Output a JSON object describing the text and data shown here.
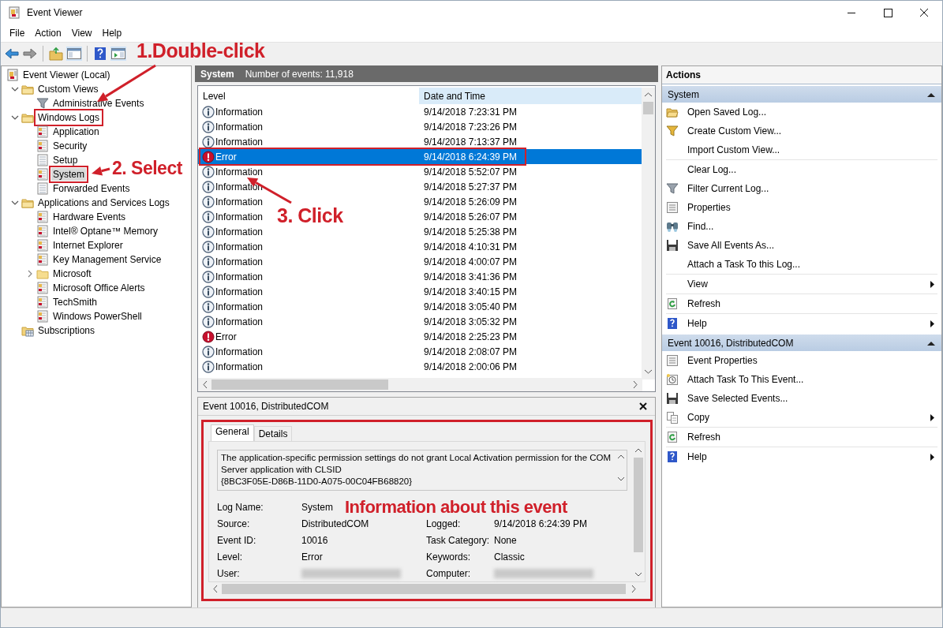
{
  "window": {
    "title": "Event Viewer"
  },
  "menu": [
    {
      "label": "File"
    },
    {
      "label": "Action"
    },
    {
      "label": "View"
    },
    {
      "label": "Help"
    }
  ],
  "tree": [
    {
      "label": "Event Viewer (Local)",
      "kind": "viewer",
      "selected": false,
      "marked": false,
      "children": [
        {
          "label": "Custom Views",
          "kind": "folder",
          "expanded": true,
          "selected": false,
          "marked": false,
          "children": [
            {
              "label": "Administrative Events",
              "kind": "filter",
              "selected": false,
              "marked": false
            }
          ]
        },
        {
          "label": "Windows Logs",
          "kind": "folder",
          "expanded": true,
          "selected": false,
          "marked": true,
          "children": [
            {
              "label": "Application",
              "kind": "log",
              "selected": false,
              "marked": false
            },
            {
              "label": "Security",
              "kind": "log",
              "selected": false,
              "marked": false
            },
            {
              "label": "Setup",
              "kind": "log-plain",
              "selected": false,
              "marked": false
            },
            {
              "label": "System",
              "kind": "log",
              "selected": true,
              "marked": true
            },
            {
              "label": "Forwarded Events",
              "kind": "log-plain",
              "selected": false,
              "marked": false
            }
          ]
        },
        {
          "label": "Applications and Services Logs",
          "kind": "folder",
          "expanded": true,
          "selected": false,
          "marked": false,
          "children": [
            {
              "label": "Hardware Events",
              "kind": "log",
              "selected": false,
              "marked": false
            },
            {
              "label": "Intel® Optane™ Memory",
              "kind": "log",
              "selected": false,
              "marked": false
            },
            {
              "label": "Internet Explorer",
              "kind": "log",
              "selected": false,
              "marked": false
            },
            {
              "label": "Key Management Service",
              "kind": "log",
              "selected": false,
              "marked": false
            },
            {
              "label": "Microsoft",
              "kind": "folder-plain",
              "expanded": false,
              "selected": false,
              "marked": false
            },
            {
              "label": "Microsoft Office Alerts",
              "kind": "log",
              "selected": false,
              "marked": false
            },
            {
              "label": "TechSmith",
              "kind": "log",
              "selected": false,
              "marked": false
            },
            {
              "label": "Windows PowerShell",
              "kind": "log",
              "selected": false,
              "marked": false
            }
          ]
        },
        {
          "label": "Subscriptions",
          "kind": "subscriptions",
          "selected": false,
          "marked": false
        }
      ]
    }
  ],
  "events": {
    "title": "System",
    "count": "Number of events: 11,918",
    "columns": [
      {
        "label": "Level",
        "sorted": false
      },
      {
        "label": "Date and Time",
        "sorted": true
      }
    ],
    "rows": [
      {
        "kind": "information",
        "level": "Information",
        "date": "9/14/2018 7:23:31 PM",
        "selected": false,
        "marked": false
      },
      {
        "kind": "information",
        "level": "Information",
        "date": "9/14/2018 7:23:26 PM",
        "selected": false,
        "marked": false
      },
      {
        "kind": "information",
        "level": "Information",
        "date": "9/14/2018 7:13:37 PM",
        "selected": false,
        "marked": false
      },
      {
        "kind": "error",
        "level": "Error",
        "date": "9/14/2018 6:24:39 PM",
        "selected": true,
        "marked": true
      },
      {
        "kind": "information",
        "level": "Information",
        "date": "9/14/2018 5:52:07 PM",
        "selected": false,
        "marked": false
      },
      {
        "kind": "information",
        "level": "Information",
        "date": "9/14/2018 5:27:37 PM",
        "selected": false,
        "marked": false
      },
      {
        "kind": "information",
        "level": "Information",
        "date": "9/14/2018 5:26:09 PM",
        "selected": false,
        "marked": false
      },
      {
        "kind": "information",
        "level": "Information",
        "date": "9/14/2018 5:26:07 PM",
        "selected": false,
        "marked": false
      },
      {
        "kind": "information",
        "level": "Information",
        "date": "9/14/2018 5:25:38 PM",
        "selected": false,
        "marked": false
      },
      {
        "kind": "information",
        "level": "Information",
        "date": "9/14/2018 4:10:31 PM",
        "selected": false,
        "marked": false
      },
      {
        "kind": "information",
        "level": "Information",
        "date": "9/14/2018 4:00:07 PM",
        "selected": false,
        "marked": false
      },
      {
        "kind": "information",
        "level": "Information",
        "date": "9/14/2018 3:41:36 PM",
        "selected": false,
        "marked": false
      },
      {
        "kind": "information",
        "level": "Information",
        "date": "9/14/2018 3:40:15 PM",
        "selected": false,
        "marked": false
      },
      {
        "kind": "information",
        "level": "Information",
        "date": "9/14/2018 3:05:40 PM",
        "selected": false,
        "marked": false
      },
      {
        "kind": "information",
        "level": "Information",
        "date": "9/14/2018 3:05:32 PM",
        "selected": false,
        "marked": false
      },
      {
        "kind": "error",
        "level": "Error",
        "date": "9/14/2018 2:25:23 PM",
        "selected": false,
        "marked": false
      },
      {
        "kind": "information",
        "level": "Information",
        "date": "9/14/2018 2:08:07 PM",
        "selected": false,
        "marked": false
      },
      {
        "kind": "information",
        "level": "Information",
        "date": "9/14/2018 2:00:06 PM",
        "selected": false,
        "marked": false
      }
    ]
  },
  "details": {
    "title": "Event 10016, DistributedCOM",
    "marked": true,
    "tabs": [
      {
        "label": "General",
        "selected": true
      },
      {
        "label": "Details",
        "selected": false
      }
    ],
    "message": "The application-specific permission settings do not grant Local Activation permission for the COM Server application with CLSID\n{8BC3F05E-D86B-11D0-A075-00C04FB68820}",
    "fields": [
      [
        {
          "label": "Log Name:",
          "value": "System"
        }
      ],
      [
        {
          "label": "Source:",
          "value": "DistributedCOM"
        },
        {
          "label": "Logged:",
          "value": "9/14/2018 6:24:39 PM"
        }
      ],
      [
        {
          "label": "Event ID:",
          "value": "10016"
        },
        {
          "label": "Task Category:",
          "value": "None"
        }
      ],
      [
        {
          "label": "Level:",
          "value": "Error"
        },
        {
          "label": "Keywords:",
          "value": "Classic"
        }
      ],
      [
        {
          "label": "User:",
          "redacted": true
        },
        {
          "label": "Computer:",
          "redacted": true
        }
      ]
    ]
  },
  "actions": {
    "title": "Actions",
    "sections": [
      {
        "title": "System",
        "expanded": true,
        "groups": [
          [
            {
              "label": "Open Saved Log...",
              "kind": "open"
            },
            {
              "label": "Create Custom View...",
              "kind": "create-view"
            },
            {
              "label": "Import Custom View..."
            }
          ],
          [
            {
              "label": "Clear Log..."
            },
            {
              "label": "Filter Current Log...",
              "kind": "filter"
            },
            {
              "label": "Properties",
              "kind": "properties"
            },
            {
              "label": "Find...",
              "kind": "find"
            },
            {
              "label": "Save All Events As...",
              "kind": "save"
            },
            {
              "label": "Attach a Task To this Log..."
            }
          ],
          [
            {
              "label": "View",
              "submenu": true
            }
          ],
          [
            {
              "label": "Refresh",
              "kind": "refresh"
            }
          ],
          [
            {
              "label": "Help",
              "kind": "help",
              "submenu": true
            }
          ]
        ]
      },
      {
        "title": "Event 10016, DistributedCOM",
        "expanded": true,
        "groups": [
          [
            {
              "label": "Event Properties",
              "kind": "properties"
            },
            {
              "label": "Attach Task To This Event...",
              "kind": "task"
            },
            {
              "label": "Save Selected Events...",
              "kind": "save"
            },
            {
              "label": "Copy",
              "kind": "copy",
              "submenu": true
            }
          ],
          [
            {
              "label": "Refresh",
              "kind": "refresh"
            }
          ],
          [
            {
              "label": "Help",
              "kind": "help",
              "submenu": true
            }
          ]
        ]
      }
    ]
  },
  "annotations": [
    {
      "text": "1.Double-click"
    },
    {
      "text": "2. Select"
    },
    {
      "text": "3. Click"
    },
    {
      "text": "Information about this event"
    }
  ]
}
